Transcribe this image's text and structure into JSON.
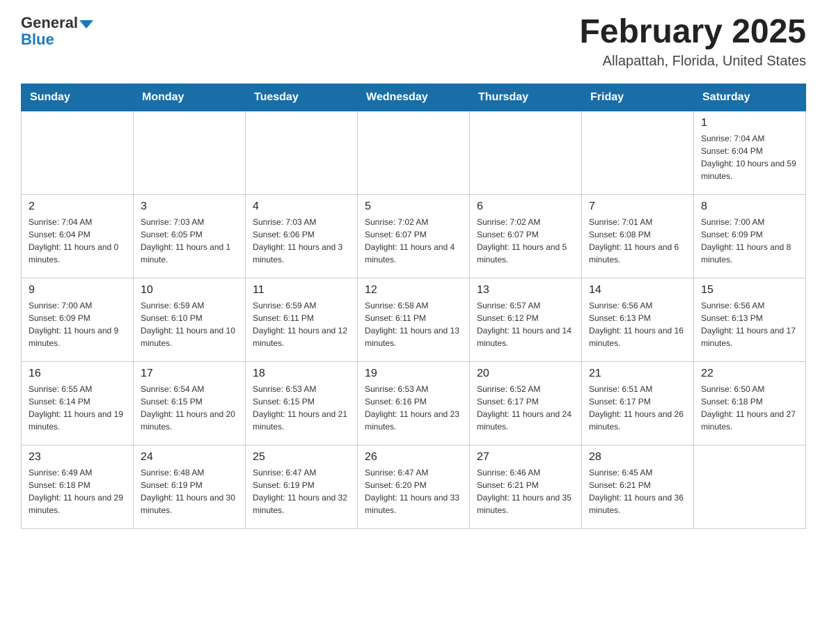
{
  "header": {
    "logo_general": "General",
    "logo_blue": "Blue",
    "title": "February 2025",
    "subtitle": "Allapattah, Florida, United States"
  },
  "days_of_week": [
    "Sunday",
    "Monday",
    "Tuesday",
    "Wednesday",
    "Thursday",
    "Friday",
    "Saturday"
  ],
  "weeks": [
    [
      {
        "day": "",
        "sunrise": "",
        "sunset": "",
        "daylight": ""
      },
      {
        "day": "",
        "sunrise": "",
        "sunset": "",
        "daylight": ""
      },
      {
        "day": "",
        "sunrise": "",
        "sunset": "",
        "daylight": ""
      },
      {
        "day": "",
        "sunrise": "",
        "sunset": "",
        "daylight": ""
      },
      {
        "day": "",
        "sunrise": "",
        "sunset": "",
        "daylight": ""
      },
      {
        "day": "",
        "sunrise": "",
        "sunset": "",
        "daylight": ""
      },
      {
        "day": "1",
        "sunrise": "Sunrise: 7:04 AM",
        "sunset": "Sunset: 6:04 PM",
        "daylight": "Daylight: 10 hours and 59 minutes."
      }
    ],
    [
      {
        "day": "2",
        "sunrise": "Sunrise: 7:04 AM",
        "sunset": "Sunset: 6:04 PM",
        "daylight": "Daylight: 11 hours and 0 minutes."
      },
      {
        "day": "3",
        "sunrise": "Sunrise: 7:03 AM",
        "sunset": "Sunset: 6:05 PM",
        "daylight": "Daylight: 11 hours and 1 minute."
      },
      {
        "day": "4",
        "sunrise": "Sunrise: 7:03 AM",
        "sunset": "Sunset: 6:06 PM",
        "daylight": "Daylight: 11 hours and 3 minutes."
      },
      {
        "day": "5",
        "sunrise": "Sunrise: 7:02 AM",
        "sunset": "Sunset: 6:07 PM",
        "daylight": "Daylight: 11 hours and 4 minutes."
      },
      {
        "day": "6",
        "sunrise": "Sunrise: 7:02 AM",
        "sunset": "Sunset: 6:07 PM",
        "daylight": "Daylight: 11 hours and 5 minutes."
      },
      {
        "day": "7",
        "sunrise": "Sunrise: 7:01 AM",
        "sunset": "Sunset: 6:08 PM",
        "daylight": "Daylight: 11 hours and 6 minutes."
      },
      {
        "day": "8",
        "sunrise": "Sunrise: 7:00 AM",
        "sunset": "Sunset: 6:09 PM",
        "daylight": "Daylight: 11 hours and 8 minutes."
      }
    ],
    [
      {
        "day": "9",
        "sunrise": "Sunrise: 7:00 AM",
        "sunset": "Sunset: 6:09 PM",
        "daylight": "Daylight: 11 hours and 9 minutes."
      },
      {
        "day": "10",
        "sunrise": "Sunrise: 6:59 AM",
        "sunset": "Sunset: 6:10 PM",
        "daylight": "Daylight: 11 hours and 10 minutes."
      },
      {
        "day": "11",
        "sunrise": "Sunrise: 6:59 AM",
        "sunset": "Sunset: 6:11 PM",
        "daylight": "Daylight: 11 hours and 12 minutes."
      },
      {
        "day": "12",
        "sunrise": "Sunrise: 6:58 AM",
        "sunset": "Sunset: 6:11 PM",
        "daylight": "Daylight: 11 hours and 13 minutes."
      },
      {
        "day": "13",
        "sunrise": "Sunrise: 6:57 AM",
        "sunset": "Sunset: 6:12 PM",
        "daylight": "Daylight: 11 hours and 14 minutes."
      },
      {
        "day": "14",
        "sunrise": "Sunrise: 6:56 AM",
        "sunset": "Sunset: 6:13 PM",
        "daylight": "Daylight: 11 hours and 16 minutes."
      },
      {
        "day": "15",
        "sunrise": "Sunrise: 6:56 AM",
        "sunset": "Sunset: 6:13 PM",
        "daylight": "Daylight: 11 hours and 17 minutes."
      }
    ],
    [
      {
        "day": "16",
        "sunrise": "Sunrise: 6:55 AM",
        "sunset": "Sunset: 6:14 PM",
        "daylight": "Daylight: 11 hours and 19 minutes."
      },
      {
        "day": "17",
        "sunrise": "Sunrise: 6:54 AM",
        "sunset": "Sunset: 6:15 PM",
        "daylight": "Daylight: 11 hours and 20 minutes."
      },
      {
        "day": "18",
        "sunrise": "Sunrise: 6:53 AM",
        "sunset": "Sunset: 6:15 PM",
        "daylight": "Daylight: 11 hours and 21 minutes."
      },
      {
        "day": "19",
        "sunrise": "Sunrise: 6:53 AM",
        "sunset": "Sunset: 6:16 PM",
        "daylight": "Daylight: 11 hours and 23 minutes."
      },
      {
        "day": "20",
        "sunrise": "Sunrise: 6:52 AM",
        "sunset": "Sunset: 6:17 PM",
        "daylight": "Daylight: 11 hours and 24 minutes."
      },
      {
        "day": "21",
        "sunrise": "Sunrise: 6:51 AM",
        "sunset": "Sunset: 6:17 PM",
        "daylight": "Daylight: 11 hours and 26 minutes."
      },
      {
        "day": "22",
        "sunrise": "Sunrise: 6:50 AM",
        "sunset": "Sunset: 6:18 PM",
        "daylight": "Daylight: 11 hours and 27 minutes."
      }
    ],
    [
      {
        "day": "23",
        "sunrise": "Sunrise: 6:49 AM",
        "sunset": "Sunset: 6:18 PM",
        "daylight": "Daylight: 11 hours and 29 minutes."
      },
      {
        "day": "24",
        "sunrise": "Sunrise: 6:48 AM",
        "sunset": "Sunset: 6:19 PM",
        "daylight": "Daylight: 11 hours and 30 minutes."
      },
      {
        "day": "25",
        "sunrise": "Sunrise: 6:47 AM",
        "sunset": "Sunset: 6:19 PM",
        "daylight": "Daylight: 11 hours and 32 minutes."
      },
      {
        "day": "26",
        "sunrise": "Sunrise: 6:47 AM",
        "sunset": "Sunset: 6:20 PM",
        "daylight": "Daylight: 11 hours and 33 minutes."
      },
      {
        "day": "27",
        "sunrise": "Sunrise: 6:46 AM",
        "sunset": "Sunset: 6:21 PM",
        "daylight": "Daylight: 11 hours and 35 minutes."
      },
      {
        "day": "28",
        "sunrise": "Sunrise: 6:45 AM",
        "sunset": "Sunset: 6:21 PM",
        "daylight": "Daylight: 11 hours and 36 minutes."
      },
      {
        "day": "",
        "sunrise": "",
        "sunset": "",
        "daylight": ""
      }
    ]
  ]
}
